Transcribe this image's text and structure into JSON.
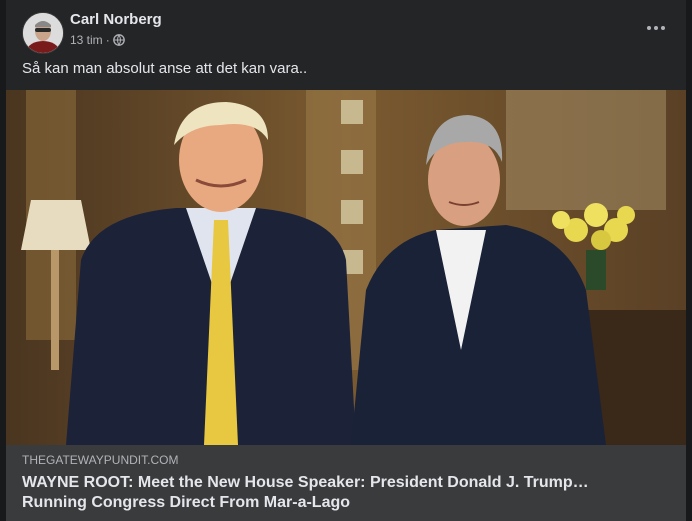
{
  "post": {
    "author": "Carl Norberg",
    "time": "13 tim",
    "separator": "·",
    "text": "Så kan man absolut anse att det kan vara..",
    "more_icon": "more-horizontal-icon",
    "privacy_icon": "globe-icon"
  },
  "link": {
    "domain": "THEGATEWAYPUNDIT.COM",
    "headline_line1": "WAYNE ROOT: Meet the New House Speaker: President Donald J. Trump…",
    "headline_line2": "Running Congress Direct From Mar-a-Lago"
  },
  "colors": {
    "background": "#18191a",
    "card": "#242526",
    "link_box": "#3a3b3c",
    "primary_text": "#e4e6eb",
    "secondary_text": "#b0b3b8"
  }
}
